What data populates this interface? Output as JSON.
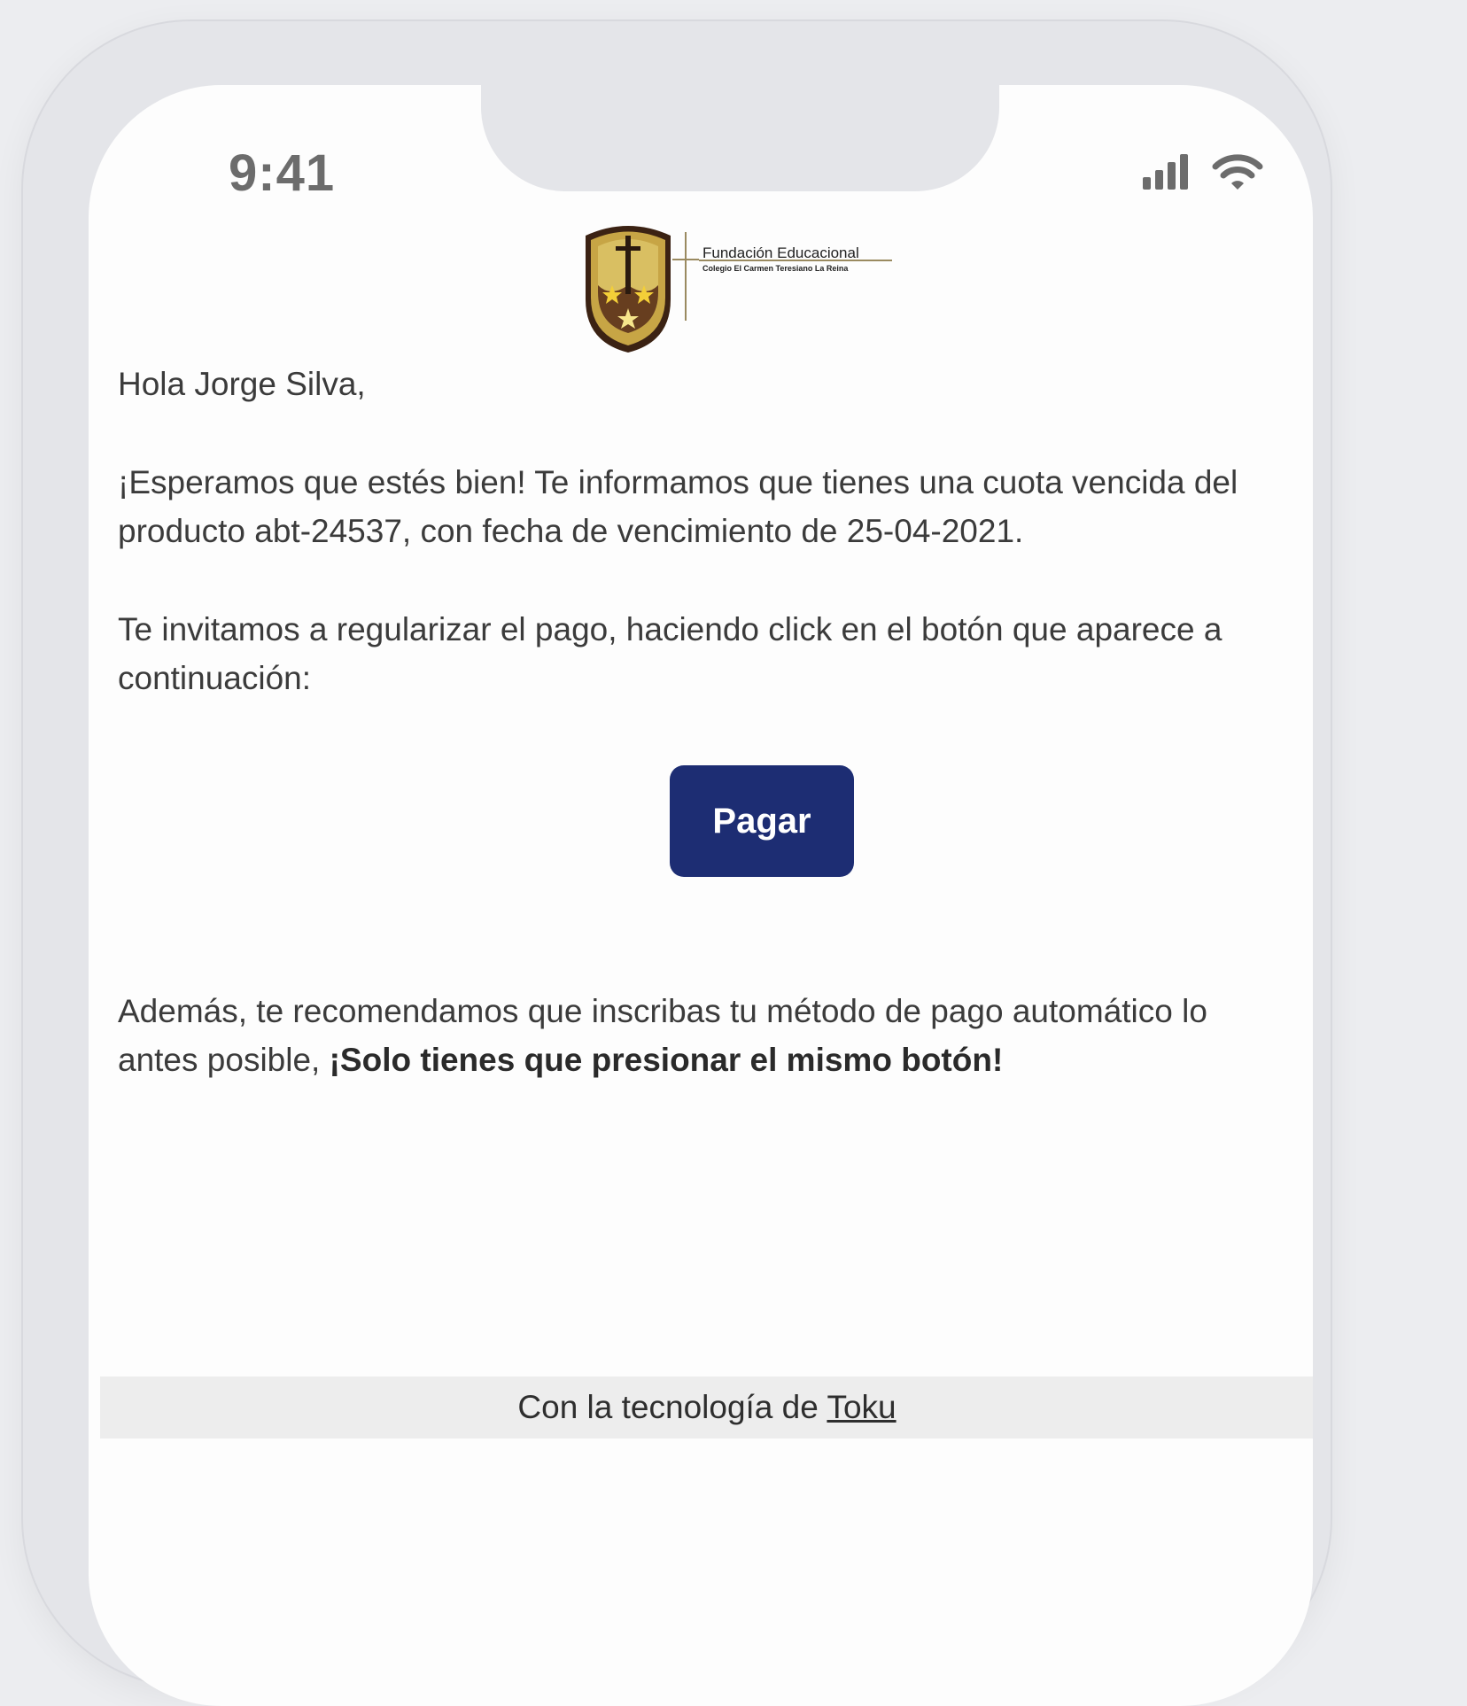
{
  "status_bar": {
    "time": "9:41"
  },
  "logo": {
    "title": "Fundación Educacional",
    "subtitle": "Colegio El Carmen Teresiano La Reina",
    "colors": {
      "shield": "#c7a545",
      "shield_dark": "#3b2213",
      "star": "#f3cf38"
    }
  },
  "email": {
    "greeting": "Hola Jorge Silva,",
    "info": "¡Esperamos que estés bien! Te informamos que tienes una cuota vencida del producto abt-24537, con fecha de vencimiento de 25-04-2021.",
    "invite": "Te invitamos a regularizar el pago, haciendo click en el botón que aparece a continuación:",
    "pay_button": "Pagar",
    "recommend_prefix": "Además, te recomendamos que inscribas tu método de pago automático lo antes posible, ",
    "recommend_bold": "¡Solo tienes que presionar el mismo botón!"
  },
  "footer": {
    "text": "Con la tecnología de ",
    "link": "Toku"
  },
  "colors": {
    "button_bg": "#1d2d73",
    "page_bg": "#ecedf0",
    "footer_bg": "#ededed"
  },
  "icons": [
    "signal-icon",
    "wifi-icon"
  ]
}
